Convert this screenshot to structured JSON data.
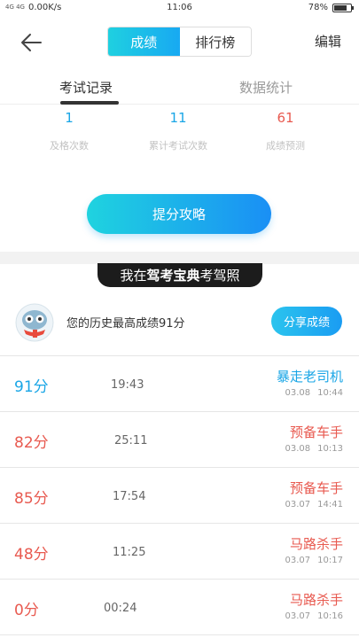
{
  "status_bar": {
    "network": "4G 4G",
    "speed": "0.00K/s",
    "time": "11:06",
    "battery": "78%",
    "battery_level": 0.78
  },
  "header": {
    "tabs": [
      "成绩",
      "排行榜"
    ],
    "edit_label": "编辑"
  },
  "sub_tabs": [
    "考试记录",
    "数据统计"
  ],
  "stats": [
    {
      "value": "1",
      "label": "及格次数"
    },
    {
      "value": "11",
      "label": "累计考试次数"
    },
    {
      "value": "61",
      "label": "成绩预测"
    }
  ],
  "cta_label": "提分攻略",
  "banner": {
    "prefix": "我在",
    "brand": "驾考宝典",
    "suffix": "考驾照"
  },
  "best": {
    "text": "您的历史最高成绩91分",
    "share_label": "分享成绩"
  },
  "records": [
    {
      "score": "91分",
      "duration": "19:43",
      "title": "暴走老司机",
      "date": "03.08",
      "time": "10:44"
    },
    {
      "score": "82分",
      "duration": "25:11",
      "title": "预备车手",
      "date": "03.08",
      "time": "10:13"
    },
    {
      "score": "85分",
      "duration": "17:54",
      "title": "预备车手",
      "date": "03.07",
      "time": "14:41"
    },
    {
      "score": "48分",
      "duration": "11:25",
      "title": "马路杀手",
      "date": "03.07",
      "time": "10:17"
    },
    {
      "score": "0分",
      "duration": "00:24",
      "title": "马路杀手",
      "date": "03.07",
      "time": "10:16"
    }
  ],
  "colors": {
    "pass": "#1aa6e6",
    "fail": "#e85a50",
    "accent": "#18a9f2"
  }
}
